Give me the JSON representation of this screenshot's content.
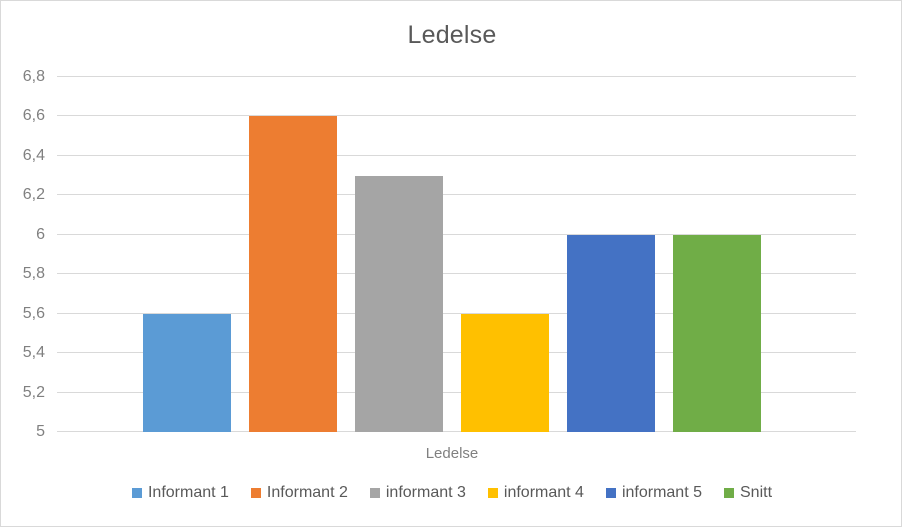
{
  "chart_data": {
    "type": "bar",
    "title": "Ledelse",
    "xlabel": "Ledelse",
    "ylabel": "",
    "categories": [
      "Ledelse"
    ],
    "grid": true,
    "legend_position": "bottom",
    "ylim": [
      5,
      6.8
    ],
    "ytick_step": 0.2,
    "decimal_separator": ",",
    "ytick_labels": [
      "6,8",
      "6,6",
      "6,4",
      "6,2",
      "6",
      "5,8",
      "5,6",
      "5,4",
      "5,2",
      "5"
    ],
    "ytick_values": [
      6.8,
      6.6,
      6.4,
      6.2,
      6.0,
      5.8,
      5.6,
      5.4,
      5.2,
      5.0
    ],
    "series": [
      {
        "name": "Informant 1",
        "values": [
          5.6
        ],
        "color": "#5B9BD5"
      },
      {
        "name": "Informant 2",
        "values": [
          6.6
        ],
        "color": "#ED7D31"
      },
      {
        "name": "informant 3",
        "values": [
          6.3
        ],
        "color": "#A5A5A5"
      },
      {
        "name": "informant 4",
        "values": [
          5.6
        ],
        "color": "#FFC000"
      },
      {
        "name": "informant 5",
        "values": [
          6.0
        ],
        "color": "#4472C4"
      },
      {
        "name": "Snitt",
        "values": [
          6.0
        ],
        "color": "#70AD47"
      }
    ]
  },
  "colors": {
    "title_text": "#595959",
    "axis_text": "#808080",
    "gridline": "#D9D9D9",
    "frame_border": "#D9D9D9",
    "plot_background": "#FFFFFF"
  }
}
